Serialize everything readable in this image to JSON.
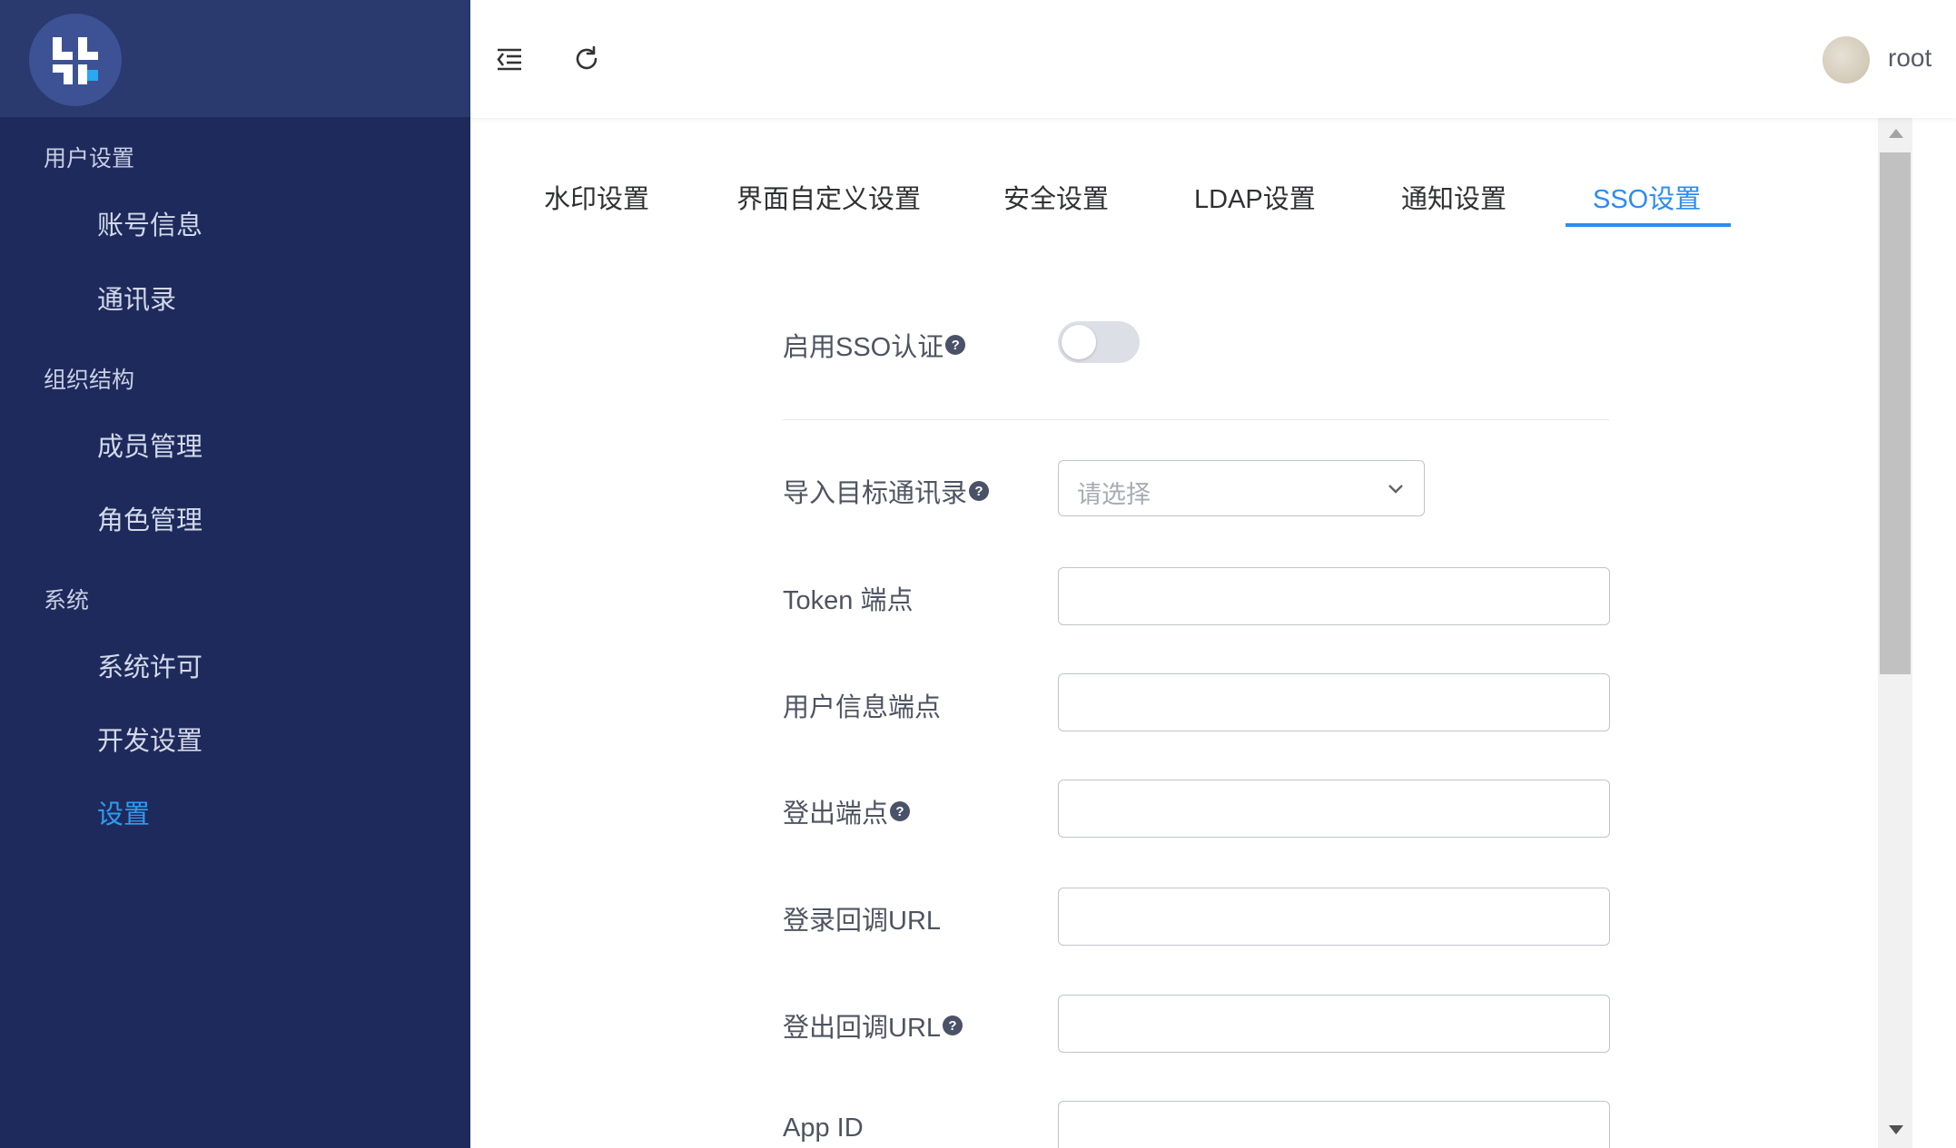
{
  "sidebar": {
    "logo_icon": "app-logo-icon",
    "groups": [
      {
        "label": "用户设置",
        "items": [
          {
            "label": "账号信息"
          },
          {
            "label": "通讯录"
          }
        ]
      },
      {
        "label": "组织结构",
        "items": [
          {
            "label": "成员管理"
          },
          {
            "label": "角色管理"
          }
        ]
      },
      {
        "label": "系统",
        "items": [
          {
            "label": "系统许可"
          },
          {
            "label": "开发设置"
          },
          {
            "label": "设置",
            "active": true
          }
        ]
      }
    ]
  },
  "header": {
    "collapse_icon": "menu-collapse-icon",
    "refresh_icon": "refresh-icon",
    "username": "root"
  },
  "tabs": [
    {
      "label": "水印设置"
    },
    {
      "label": "界面自定义设置"
    },
    {
      "label": "安全设置"
    },
    {
      "label": "LDAP设置"
    },
    {
      "label": "通知设置"
    },
    {
      "label": "SSO设置",
      "active": true
    }
  ],
  "form": {
    "enable_sso": {
      "label": "启用SSO认证",
      "help": "?",
      "enabled": false
    },
    "import_directory": {
      "label": "导入目标通讯录",
      "help": "?",
      "placeholder": "请选择"
    },
    "token_endpoint": {
      "label": "Token 端点",
      "value": ""
    },
    "userinfo_endpoint": {
      "label": "用户信息端点",
      "value": ""
    },
    "logout_endpoint": {
      "label": "登出端点",
      "help": "?",
      "value": ""
    },
    "login_callback_url": {
      "label": "登录回调URL",
      "value": ""
    },
    "logout_callback_url": {
      "label": "登出回调URL",
      "help": "?",
      "value": ""
    },
    "app_id": {
      "label": "App ID",
      "value": ""
    }
  },
  "colors": {
    "sidebar_bg": "#1e2a5b",
    "accent": "#2d8cf0"
  }
}
